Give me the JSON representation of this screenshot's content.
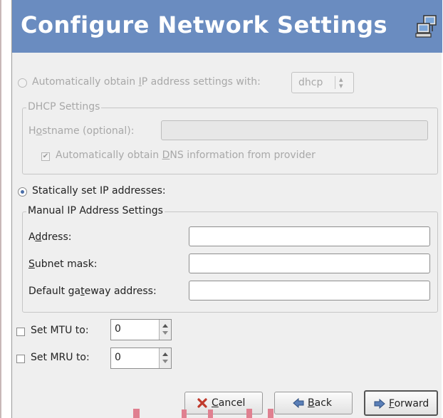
{
  "header": {
    "title": "Configure Network Settings",
    "icon": "network-computers-icon"
  },
  "auto": {
    "label_pre": "Automatically obtain ",
    "label_ul": "I",
    "label_post": "P address settings with:",
    "combo_value": "dhcp"
  },
  "dhcp": {
    "frame_title": "DHCP Settings",
    "hostname_pre": "H",
    "hostname_ul": "o",
    "hostname_post": "stname (optional):",
    "hostname_value": "",
    "dns_pre": "Automatically obtain ",
    "dns_ul": "D",
    "dns_post": "NS information from provider",
    "dns_checked": true
  },
  "static": {
    "label": "Statically set IP addresses:"
  },
  "manual": {
    "frame_title": "Manual IP Address Settings",
    "address_pre": "A",
    "address_ul": "d",
    "address_post": "dress:",
    "subnet_pre": "",
    "subnet_ul": "S",
    "subnet_post": "ubnet mask:",
    "gateway_pre": "Default ga",
    "gateway_ul": "t",
    "gateway_post": "eway address:",
    "address_value": "",
    "subnet_value": "",
    "gateway_value": ""
  },
  "mtu": {
    "label": "Set MTU to:",
    "value": "0"
  },
  "mru": {
    "label": "Set MRU to:",
    "value": "0"
  },
  "buttons": {
    "cancel_ul": "C",
    "cancel_rest": "ancel",
    "back_ul": "B",
    "back_rest": "ack",
    "forward_ul": "F",
    "forward_rest": "orward"
  },
  "colors": {
    "header": "#6a8cc0",
    "accent_bar": "#e08090"
  }
}
